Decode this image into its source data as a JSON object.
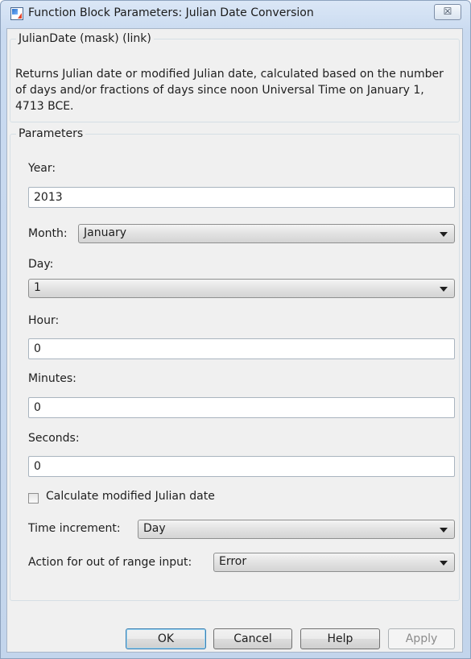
{
  "window": {
    "title": "Function Block Parameters: Julian Date Conversion",
    "close_symbol": "☒",
    "app_icon": "simulink-block-icon"
  },
  "description_group": {
    "legend": "JulianDate (mask) (link)",
    "text": "Returns Julian date or modified Julian date, calculated based on the number of days and/or fractions of days since noon Universal Time on January 1, 4713 BCE."
  },
  "parameters": {
    "legend": "Parameters",
    "year": {
      "label": "Year:",
      "value": "2013"
    },
    "month": {
      "label": "Month:",
      "value": "January"
    },
    "day": {
      "label": "Day:",
      "value": "1"
    },
    "hour": {
      "label": "Hour:",
      "value": "0"
    },
    "minutes": {
      "label": "Minutes:",
      "value": "0"
    },
    "seconds": {
      "label": "Seconds:",
      "value": "0"
    },
    "modified_julian": {
      "label": "Calculate modified Julian date",
      "checked": false
    },
    "time_increment": {
      "label": "Time increment:",
      "value": "Day"
    },
    "out_of_range": {
      "label": "Action for out of range input:",
      "value": "Error"
    }
  },
  "buttons": {
    "ok": "OK",
    "cancel": "Cancel",
    "help": "Help",
    "apply": "Apply"
  }
}
